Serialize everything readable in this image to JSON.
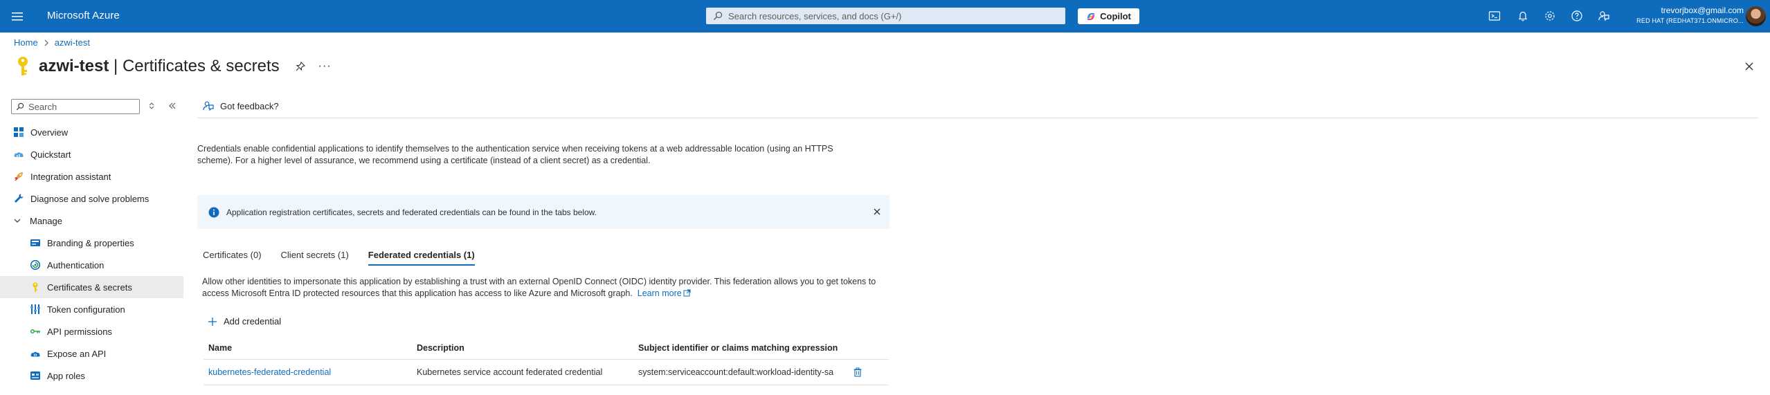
{
  "topbar": {
    "brand": "Microsoft Azure",
    "search_placeholder": "Search resources, services, and docs (G+/)",
    "copilot_label": "Copilot",
    "account_email": "trevorjbox@gmail.com",
    "account_tenant": "RED HAT (REDHAT371.ONMICRO..."
  },
  "breadcrumb": {
    "home": "Home",
    "current": "azwi-test"
  },
  "page": {
    "title_app": "azwi-test",
    "title_sep": " | ",
    "title_blade": "Certificates & secrets",
    "more": "···"
  },
  "nav": {
    "search_placeholder": "Search",
    "items": [
      {
        "label": "Overview"
      },
      {
        "label": "Quickstart"
      },
      {
        "label": "Integration assistant"
      },
      {
        "label": "Diagnose and solve problems"
      },
      {
        "label": "Manage"
      },
      {
        "label": "Branding & properties"
      },
      {
        "label": "Authentication"
      },
      {
        "label": "Certificates & secrets"
      },
      {
        "label": "Token configuration"
      },
      {
        "label": "API permissions"
      },
      {
        "label": "Expose an API"
      },
      {
        "label": "App roles"
      }
    ]
  },
  "content": {
    "feedback": "Got feedback?",
    "description": "Credentials enable confidential applications to identify themselves to the authentication service when receiving tokens at a web addressable location (using an HTTPS scheme). For a higher level of assurance, we recommend using a certificate (instead of a client secret) as a credential.",
    "info_banner": "Application registration certificates, secrets and federated credentials can be found in the tabs below.",
    "tabs": [
      {
        "label": "Certificates (0)"
      },
      {
        "label": "Client secrets (1)"
      },
      {
        "label": "Federated credentials (1)"
      }
    ],
    "tab_description": "Allow other identities to impersonate this application by establishing a trust with an external OpenID Connect (OIDC) identity provider. This federation allows you to get tokens to access Microsoft Entra ID protected resources that this application has access to like Azure and Microsoft graph.",
    "learn_more": "Learn more",
    "add_credential": "Add credential",
    "table": {
      "headers": [
        "Name",
        "Description",
        "Subject identifier or claims matching expression"
      ],
      "rows": [
        [
          "kubernetes-federated-credential",
          "Kubernetes service account federated credential",
          "system:serviceaccount:default:workload-identity-sa"
        ]
      ]
    }
  },
  "colors": {
    "accent": "#0f6cbd",
    "info_bg": "#eff6fc",
    "active_nav": "#ebebeb"
  }
}
